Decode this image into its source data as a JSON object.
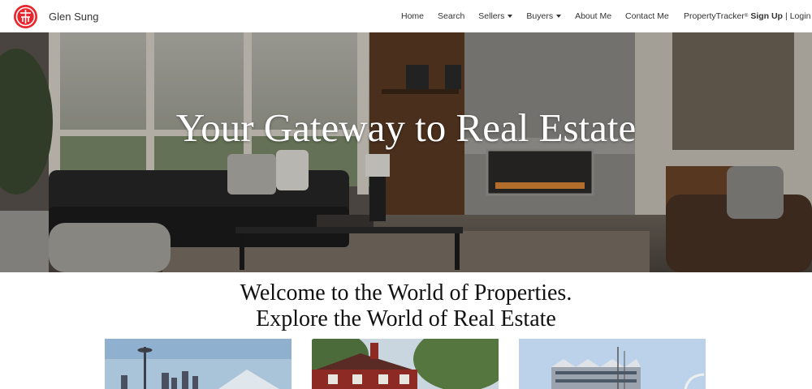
{
  "navbar": {
    "brand_name": "Glen Sung",
    "logo_icon": "ring-logo-icon",
    "links": [
      {
        "label": "Home",
        "dropdown": false
      },
      {
        "label": "Search",
        "dropdown": false
      },
      {
        "label": "Sellers",
        "dropdown": true
      },
      {
        "label": "Buyers",
        "dropdown": true
      },
      {
        "label": "About Me",
        "dropdown": false
      },
      {
        "label": "Contact Me",
        "dropdown": false
      }
    ],
    "tracker": {
      "name": "PropertyTracker",
      "mark": "®",
      "signup": "Sign Up",
      "separator": "|",
      "login": "Login"
    }
  },
  "hero": {
    "title": "Your Gateway to Real Estate"
  },
  "welcome": {
    "line1": "Welcome to the World of Properties.",
    "line2": "Explore the World of Real Estate"
  },
  "cards": [
    {
      "image": "seattle-skyline"
    },
    {
      "image": "red-house"
    },
    {
      "image": "waterfront-building"
    }
  ],
  "colors": {
    "brand_red": "#e8262d",
    "nav_text": "#333333",
    "heading_text": "#111111"
  }
}
